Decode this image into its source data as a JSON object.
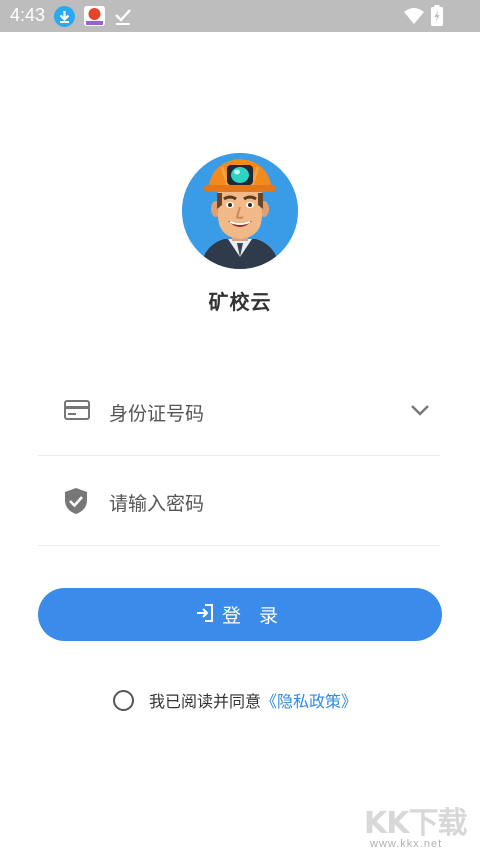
{
  "status_bar": {
    "time": "4:43",
    "icons": [
      "download-icon",
      "app-notification-icon",
      "checkmark-icon",
      "wifi-icon",
      "battery-charging-icon"
    ]
  },
  "app": {
    "name": "矿校云",
    "logo": "miner-avatar-logo"
  },
  "form": {
    "id_field_placeholder": "身份证号码",
    "id_field_icon": "id-card-icon",
    "password_placeholder": "请输入密码",
    "password_icon": "shield-check-icon",
    "login_label": "登 录",
    "login_icon": "login-icon"
  },
  "agreement": {
    "text": "我已阅读并同意",
    "link": "《隐私政策》",
    "checked": false
  },
  "watermark": {
    "logo": "KK下载",
    "url": "www.kkx.net"
  },
  "colors": {
    "primary": "#3b8cea",
    "link": "#2f8be0",
    "status_bar": "#bdbdbd",
    "logo_bg": "#3a9be6"
  }
}
